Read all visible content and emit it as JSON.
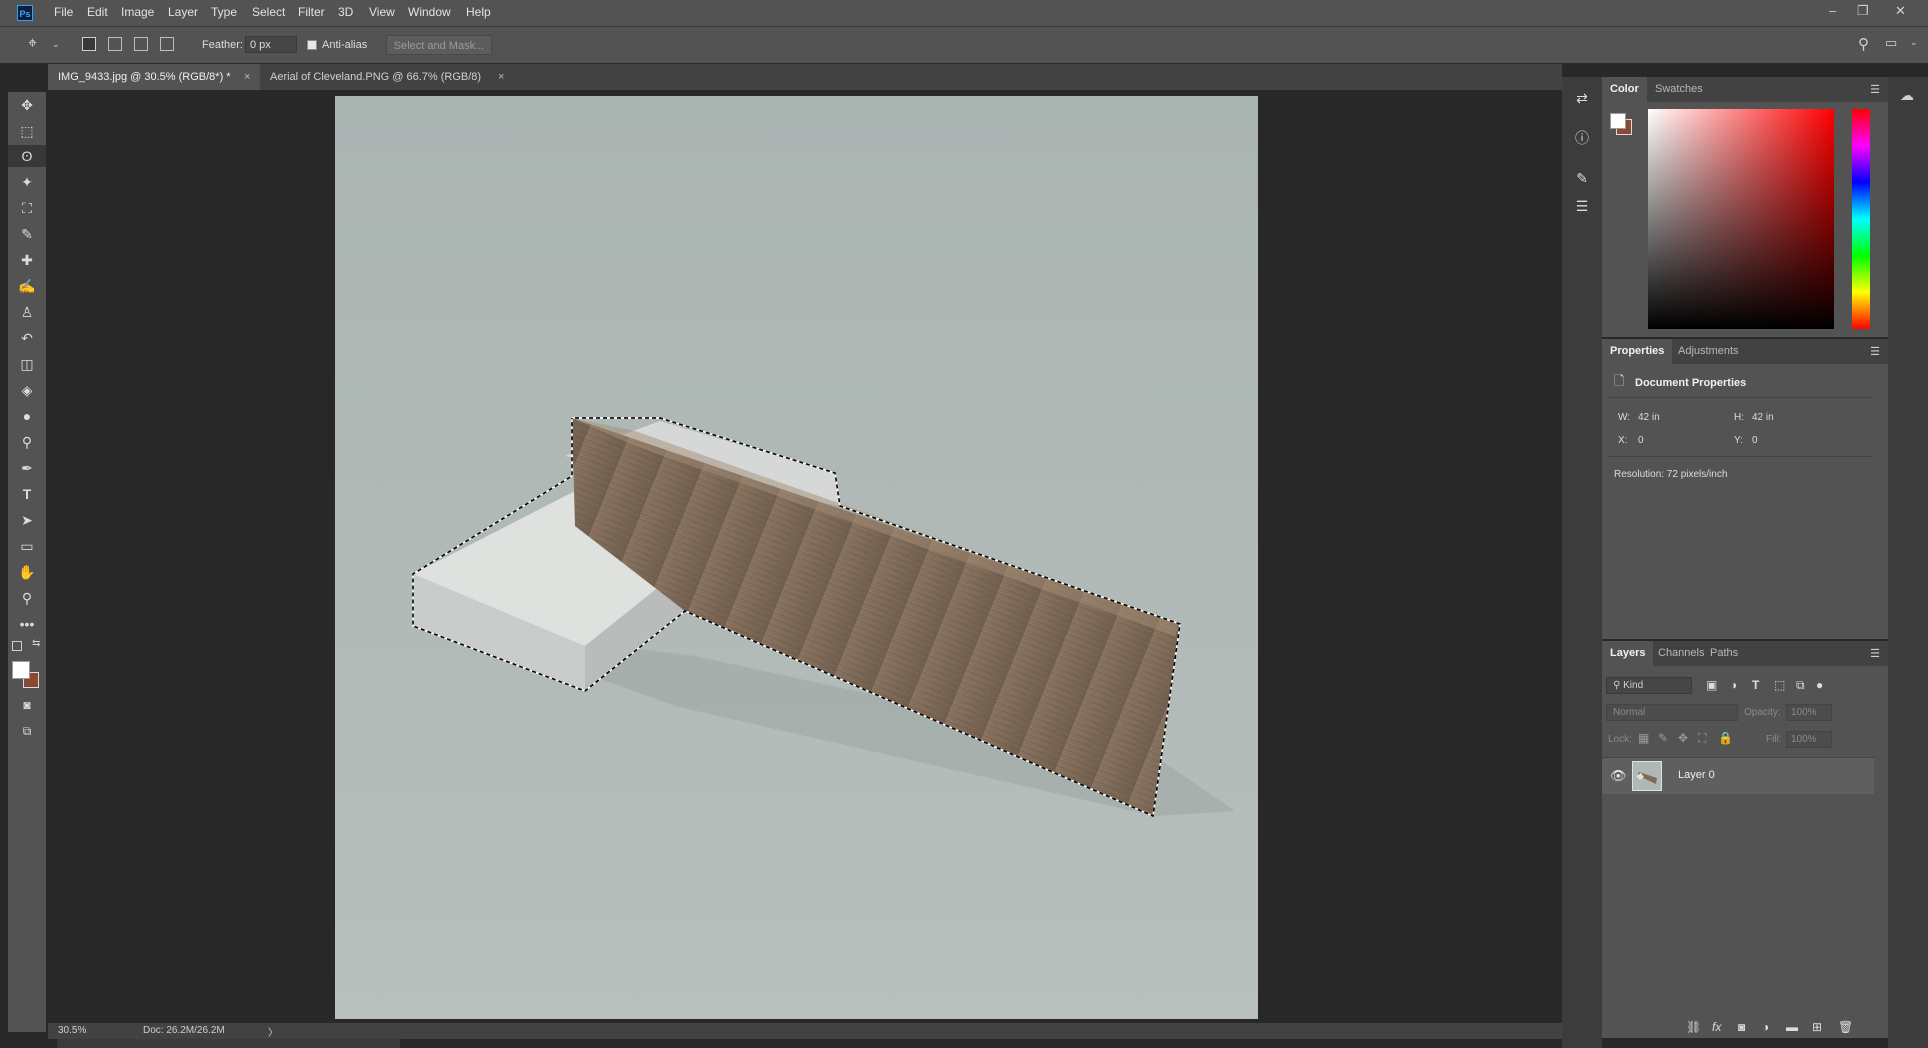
{
  "app": {
    "logo": "Ps"
  },
  "menu": [
    "File",
    "Edit",
    "Image",
    "Layer",
    "Type",
    "Select",
    "Filter",
    "3D",
    "View",
    "Window",
    "Help"
  ],
  "window_controls": {
    "minimize": "–",
    "restore": "❐",
    "close": "✕"
  },
  "options": {
    "feather_label": "Feather:",
    "feather_value": "0 px",
    "antialias_label": "Anti-alias",
    "antialias_checked": true,
    "select_mask_label": "Select and Mask..."
  },
  "tabs": [
    {
      "label": "IMG_9433.jpg @ 30.5% (RGB/8*) *",
      "close": "×",
      "active": true
    },
    {
      "label": "Aerial of Cleveland.PNG @ 66.7% (RGB/8)",
      "close": "×",
      "active": false
    }
  ],
  "status": {
    "zoom": "30.5%",
    "doc": "Doc: 26.2M/26.2M",
    "arrow": "〉"
  },
  "color_panel": {
    "tabs": [
      "Color",
      "Swatches"
    ],
    "foreground": "#ffffff",
    "background": "#8a4a32"
  },
  "properties_panel": {
    "tabs": [
      "Properties",
      "Adjustments"
    ],
    "title": "Document Properties",
    "w_label": "W:",
    "w_value": "42 in",
    "h_label": "H:",
    "h_value": "42 in",
    "x_label": "X:",
    "x_value": "0",
    "y_label": "Y:",
    "y_value": "0",
    "resolution": "Resolution: 72 pixels/inch"
  },
  "layers_panel": {
    "tabs": [
      "Layers",
      "Channels",
      "Paths"
    ],
    "kind_label": "Kind",
    "blend_mode": "Normal",
    "opacity_label": "Opacity:",
    "opacity_value": "100%",
    "lock_label": "Lock:",
    "fill_label": "Fill:",
    "fill_value": "100%",
    "layers": [
      {
        "name": "Layer 0",
        "visible": true
      }
    ]
  },
  "icons": {
    "panel_menu": "hamburger-icon",
    "eye": "eye-icon"
  }
}
